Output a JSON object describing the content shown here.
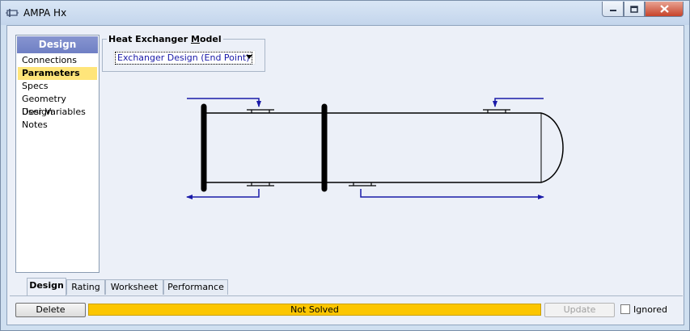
{
  "window": {
    "title": "AMPA Hx"
  },
  "nav": {
    "header": "Design",
    "items": [
      {
        "label": "Connections"
      },
      {
        "label": "Parameters",
        "selected": true
      },
      {
        "label": "Specs"
      },
      {
        "label": "Geometry Design"
      },
      {
        "label": "User Variables"
      },
      {
        "label": "Notes"
      }
    ]
  },
  "model": {
    "group_label": "Heat Exchanger Model",
    "group_label_pre": "Heat Exchanger ",
    "group_label_key": "M",
    "group_label_post": "odel",
    "selected": "Exchanger Design (End Point)"
  },
  "tabs": [
    {
      "label": "Design",
      "active": true
    },
    {
      "label": "Rating"
    },
    {
      "label": "Worksheet"
    },
    {
      "label": "Performance"
    }
  ],
  "footer": {
    "delete_label": "Delete",
    "status_text": "Not Solved",
    "update_label": "Update",
    "ignored_label": "Ignored"
  },
  "colors": {
    "status": "#fcc600",
    "nav_header": "#7080c4",
    "nav_selected": "#ffe57a",
    "stream_arrow": "#1a1aa8"
  },
  "icons": [
    "heat-exchanger-icon",
    "minimize-icon",
    "maximize-icon",
    "close-icon",
    "dropdown-arrow-icon"
  ]
}
